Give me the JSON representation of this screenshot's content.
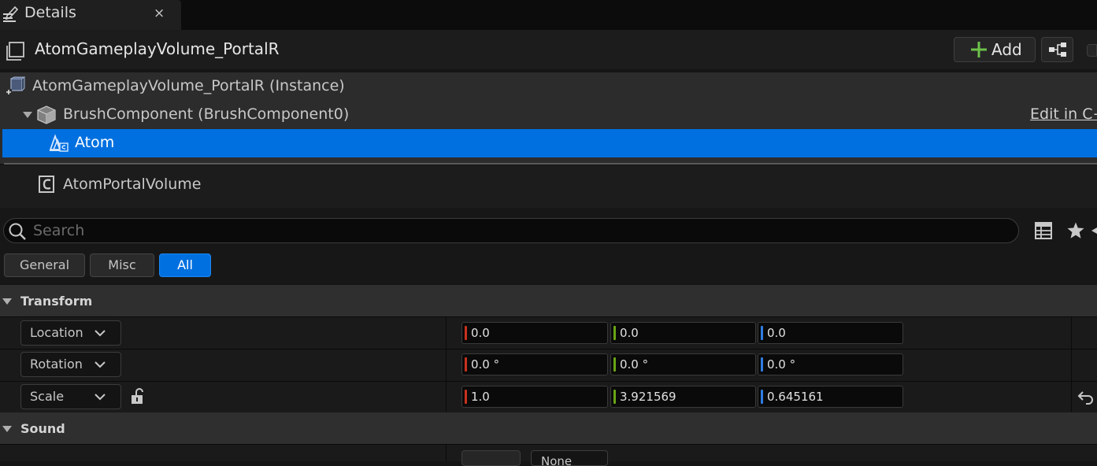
{
  "tab": {
    "title": "Details",
    "close": "×"
  },
  "actor": {
    "name": "AtomGameplayVolume_PortalR",
    "add_label": "Add"
  },
  "tree": {
    "instance": "AtomGameplayVolume_PortalR (Instance)",
    "brush": "BrushComponent (BrushComponent0)",
    "edit_link": "Edit in C++",
    "atom": "Atom",
    "class": "AtomPortalVolume"
  },
  "search": {
    "placeholder": "Search",
    "value": ""
  },
  "filters": [
    "General",
    "Misc",
    "All"
  ],
  "transform": {
    "title": "Transform",
    "location": {
      "label": "Location",
      "x": "0.0",
      "y": "0.0",
      "z": "0.0"
    },
    "rotation": {
      "label": "Rotation",
      "x": "0.0 °",
      "y": "0.0 °",
      "z": "0.0 °"
    },
    "scale": {
      "label": "Scale",
      "x": "1.0",
      "y": "3.921569",
      "z": "0.645161"
    }
  },
  "sound": {
    "title": "Sound",
    "value": "None"
  },
  "colors": {
    "accent": "#0070e0",
    "x_axis": "#c8321e",
    "y_axis": "#6aa516",
    "z_axis": "#2f7ce0",
    "add_plus": "#6cc24a"
  },
  "icons": [
    "edit-details-icon",
    "close-icon",
    "actor-icon",
    "plus-icon",
    "blueprint-icon",
    "instance-icon",
    "box-component-icon",
    "atom-component-icon",
    "class-icon",
    "search-icon",
    "table-view-icon",
    "star-icon",
    "expand-arrow-icon",
    "chevron-down-icon",
    "lock-icon",
    "reset-icon"
  ]
}
